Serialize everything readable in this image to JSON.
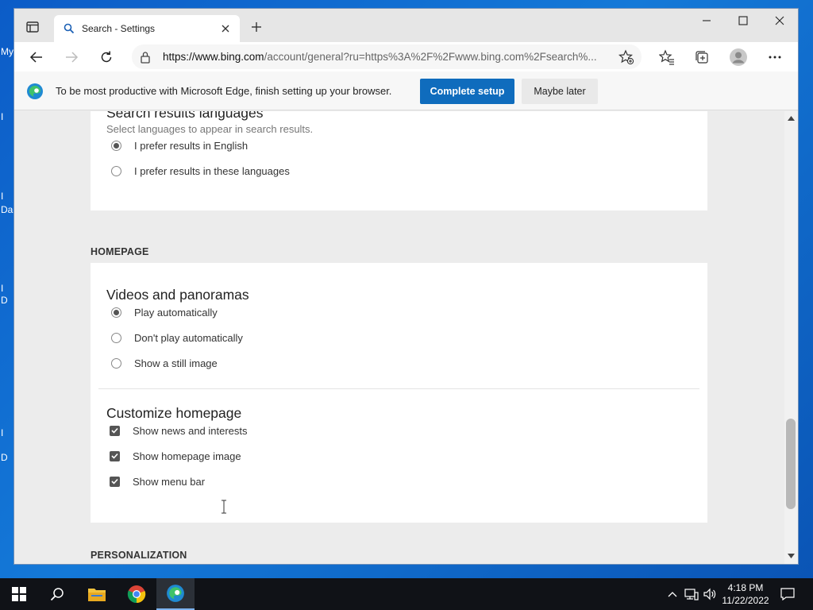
{
  "desktop": {
    "fragments": [
      "My",
      "I",
      "I",
      "Da",
      "I",
      "D",
      "I",
      "D"
    ]
  },
  "browser": {
    "tab": {
      "title": "Search - Settings"
    },
    "address": {
      "host": "https://www.bing.com",
      "path": "/account/general?ru=https%3A%2F%2Fwww.bing.com%2Fsearch%..."
    },
    "infobar": {
      "message": "To be most productive with Microsoft Edge, finish setting up your browser.",
      "primary_label": "Complete setup",
      "secondary_label": "Maybe later"
    }
  },
  "settings": {
    "languages": {
      "title": "Search results languages",
      "subtitle": "Select languages to appear in search results.",
      "options": [
        {
          "label": "I prefer results in English",
          "selected": true
        },
        {
          "label": "I prefer results in these languages",
          "selected": false
        }
      ]
    },
    "homepage_heading": "HOMEPAGE",
    "videos": {
      "title": "Videos and panoramas",
      "options": [
        {
          "label": "Play automatically",
          "selected": true
        },
        {
          "label": "Don't play automatically",
          "selected": false
        },
        {
          "label": "Show a still image",
          "selected": false
        }
      ]
    },
    "customize": {
      "title": "Customize homepage",
      "options": [
        {
          "label": "Show news and interests",
          "checked": true
        },
        {
          "label": "Show homepage image",
          "checked": true
        },
        {
          "label": "Show menu bar",
          "checked": true
        }
      ]
    },
    "personalization_heading": "PERSONALIZATION"
  },
  "taskbar": {
    "time": "4:18 PM",
    "date": "11/22/2022"
  },
  "colors": {
    "accent": "#0f6cbd",
    "desktop": "#1479d8",
    "taskbar": "#101217"
  }
}
